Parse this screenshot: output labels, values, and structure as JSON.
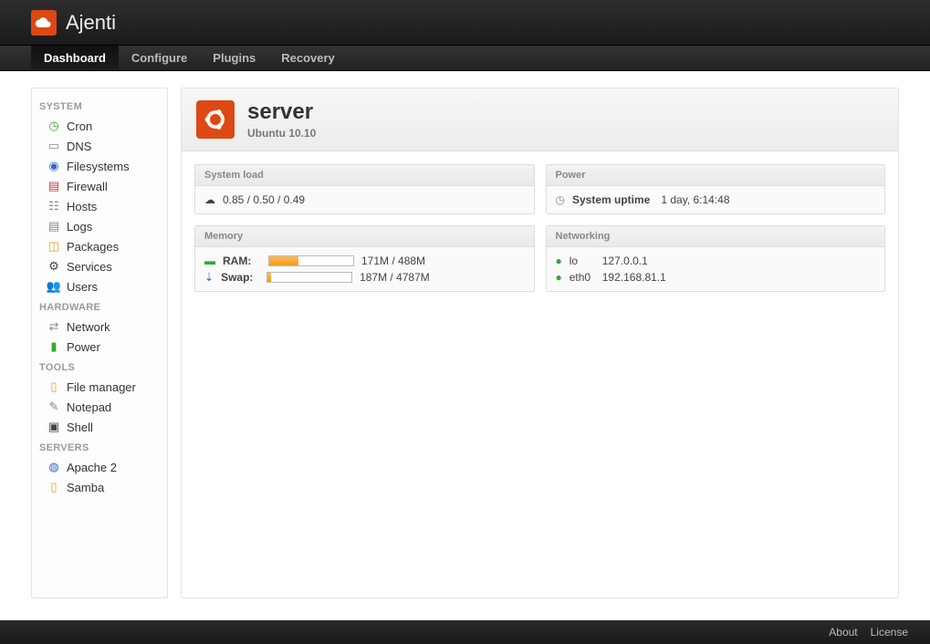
{
  "brand": "Ajenti",
  "nav": {
    "items": [
      {
        "label": "Dashboard",
        "active": true
      },
      {
        "label": "Configure",
        "active": false
      },
      {
        "label": "Plugins",
        "active": false
      },
      {
        "label": "Recovery",
        "active": false
      }
    ]
  },
  "sidebar": {
    "sections": [
      {
        "title": "SYSTEM",
        "items": [
          {
            "label": "Cron",
            "icon": "cron"
          },
          {
            "label": "DNS",
            "icon": "dns"
          },
          {
            "label": "Filesystems",
            "icon": "fs"
          },
          {
            "label": "Firewall",
            "icon": "firewall"
          },
          {
            "label": "Hosts",
            "icon": "hosts"
          },
          {
            "label": "Logs",
            "icon": "logs"
          },
          {
            "label": "Packages",
            "icon": "packages"
          },
          {
            "label": "Services",
            "icon": "services"
          },
          {
            "label": "Users",
            "icon": "users"
          }
        ]
      },
      {
        "title": "HARDWARE",
        "items": [
          {
            "label": "Network",
            "icon": "network"
          },
          {
            "label": "Power",
            "icon": "power"
          }
        ]
      },
      {
        "title": "TOOLS",
        "items": [
          {
            "label": "File manager",
            "icon": "filemgr"
          },
          {
            "label": "Notepad",
            "icon": "notepad"
          },
          {
            "label": "Shell",
            "icon": "shell"
          }
        ]
      },
      {
        "title": "SERVERS",
        "items": [
          {
            "label": "Apache 2",
            "icon": "apache"
          },
          {
            "label": "Samba",
            "icon": "samba"
          }
        ]
      }
    ]
  },
  "page": {
    "title": "server",
    "subtitle": "Ubuntu 10.10"
  },
  "widgets": {
    "load": {
      "title": "System load",
      "value": "0.85 / 0.50 / 0.49"
    },
    "power": {
      "title": "Power",
      "uptime_label": "System uptime",
      "uptime_value": "1 day, 6:14:48"
    },
    "memory": {
      "title": "Memory",
      "rows": [
        {
          "label": "RAM:",
          "used_text": "171M / 488M",
          "pct": 35
        },
        {
          "label": "Swap:",
          "used_text": "187M / 4787M",
          "pct": 4
        }
      ]
    },
    "networking": {
      "title": "Networking",
      "ifaces": [
        {
          "name": "lo",
          "addr": "127.0.0.1"
        },
        {
          "name": "eth0",
          "addr": "192.168.81.1"
        }
      ]
    }
  },
  "footer": {
    "about": "About",
    "license": "License"
  }
}
